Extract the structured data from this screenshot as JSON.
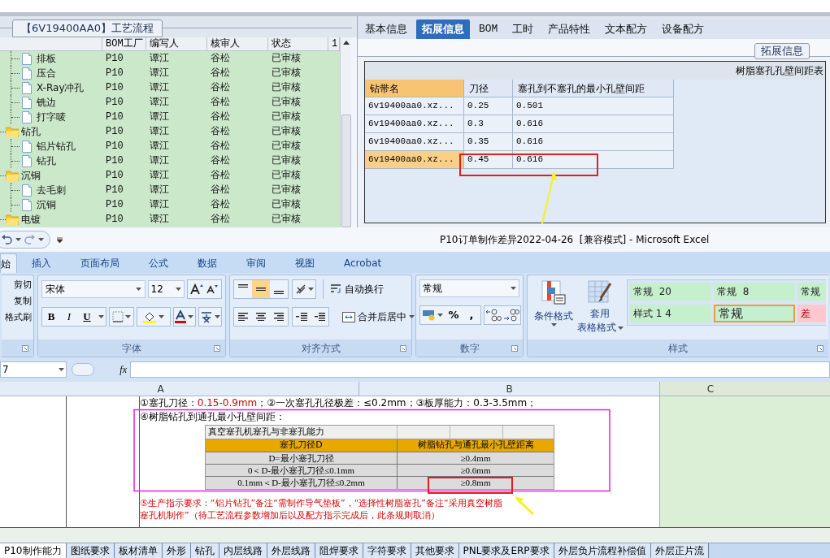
{
  "process_panel": {
    "title": "【6V19400AA0】工艺流程",
    "columns": [
      "BOM工厂",
      "编写人",
      "核审人",
      "状态",
      "1"
    ],
    "tree": [
      {
        "kind": "group",
        "children": [
          {
            "kind": "file",
            "label": "排板",
            "cells": [
              "P10",
              "谭江",
              "谷松",
              "已审核"
            ]
          },
          {
            "kind": "file",
            "label": "压合",
            "cells": [
              "P10",
              "谭江",
              "谷松",
              "已审核"
            ]
          },
          {
            "kind": "file",
            "label": "X-Ray冲孔",
            "cells": [
              "P10",
              "谭江",
              "谷松",
              "已审核"
            ]
          },
          {
            "kind": "file",
            "label": "铣边",
            "cells": [
              "P10",
              "谭江",
              "谷松",
              "已审核"
            ]
          },
          {
            "kind": "file",
            "label": "打字唛",
            "cells": [
              "P10",
              "谭江",
              "谷松",
              "已审核"
            ]
          }
        ]
      },
      {
        "kind": "folder",
        "label": "钻孔",
        "cells": [
          "P10",
          "谭江",
          "谷松",
          "已审核"
        ],
        "children": [
          {
            "kind": "file",
            "label": "铝片钻孔",
            "cells": [
              "P10",
              "谭江",
              "谷松",
              "已审核"
            ]
          },
          {
            "kind": "file",
            "label": "钻孔",
            "cells": [
              "P10",
              "谭江",
              "谷松",
              "已审核"
            ]
          }
        ]
      },
      {
        "kind": "folder",
        "label": "沉铜",
        "cells": [
          "P10",
          "谭江",
          "谷松",
          "已审核"
        ],
        "children": [
          {
            "kind": "file",
            "label": "去毛刺",
            "cells": [
              "P10",
              "谭江",
              "谷松",
              "已审核"
            ]
          },
          {
            "kind": "file",
            "label": "沉铜",
            "cells": [
              "P10",
              "谭江",
              "谷松",
              "已审核"
            ]
          }
        ]
      },
      {
        "kind": "folder",
        "label": "电镀",
        "cells": [
          "P10",
          "谭江",
          "谷松",
          "已审核"
        ]
      }
    ]
  },
  "detail_panel": {
    "tabs": [
      {
        "label": "基本信息",
        "selected": false
      },
      {
        "label": "拓展信息",
        "selected": true
      },
      {
        "label": "BOM",
        "selected": false
      },
      {
        "label": "工时",
        "selected": false
      },
      {
        "label": "产品特性",
        "selected": false
      },
      {
        "label": "文本配方",
        "selected": false
      },
      {
        "label": "设备配方",
        "selected": false
      }
    ],
    "group_title": "拓展信息",
    "table_title": "树脂塞孔孔壁间距表",
    "columns": [
      "钻带名",
      "刀径",
      "塞孔到不塞孔的最小孔壁间距"
    ],
    "rows": [
      {
        "cells": [
          "6v19400aa0.xz...",
          "0.25",
          "0.501"
        ],
        "selected": false
      },
      {
        "cells": [
          "6v19400aa0.xz...",
          "0.3",
          "0.616"
        ],
        "selected": false
      },
      {
        "cells": [
          "6v19400aa0.xz...",
          "0.35",
          "0.616"
        ],
        "selected": false
      },
      {
        "cells": [
          "6v19400aa0.xz...",
          "0.45",
          "0.616"
        ],
        "selected": true
      }
    ]
  },
  "excel": {
    "title": "P10订单制作差异2022-04-26  [兼容模式] - Microsoft Excel",
    "ribbon_tabs": [
      {
        "label": "始",
        "selected": true
      },
      {
        "label": "插入",
        "selected": false
      },
      {
        "label": "页面布局",
        "selected": false
      },
      {
        "label": "公式",
        "selected": false
      },
      {
        "label": "数据",
        "selected": false
      },
      {
        "label": "审阅",
        "selected": false
      },
      {
        "label": "视图",
        "selected": false
      },
      {
        "label": "Acrobat",
        "selected": false
      }
    ],
    "clipboard": {
      "items": [
        "剪切",
        "复制",
        "格式刷"
      ]
    },
    "font": {
      "name": "宋体",
      "size": "12",
      "style_buttons": [
        "B",
        "I",
        "U"
      ],
      "label": "字体"
    },
    "alignment": {
      "vertical": [
        {
          "kind": "top",
          "selected": false
        },
        {
          "kind": "middle",
          "selected": true
        },
        {
          "kind": "bottom",
          "selected": false
        }
      ],
      "wrap": "自动换行",
      "merge": "合并后居中",
      "label": "对齐方式"
    },
    "number": {
      "format": "常规",
      "buttons": [
        "%",
        ","
      ],
      "label": "数字"
    },
    "styles": {
      "conditional": "条件格式",
      "table_format": [
        "套用",
        "表格格式"
      ],
      "cells": [
        {
          "label": "常规  20",
          "kind": "normal",
          "selected": false
        },
        {
          "label": "常规  8",
          "kind": "normal",
          "selected": false
        },
        {
          "label": "常规",
          "kind": "normal",
          "selected": false
        },
        {
          "label": "样式 1 4",
          "kind": "normal",
          "selected": false
        },
        {
          "label": "常规",
          "kind": "normal",
          "selected": true
        },
        {
          "label": "差",
          "kind": "bad",
          "selected": false
        }
      ],
      "label": "样式"
    },
    "name_box": "7",
    "formula_label": "fx",
    "columns": [
      "A",
      "B",
      "C"
    ],
    "lines": [
      [
        {
          "text": "①塞孔刀径：",
          "red": false
        },
        {
          "text": "0.15-0.9mm",
          "red": true
        },
        {
          "text": "；②一次塞孔孔径极差：≤0.2mm；③板厚能力：0.3-3.5mm；",
          "red": false
        }
      ],
      [
        {
          "text": "④树脂钻孔到通孔最小孔壁间距：",
          "red": false
        }
      ]
    ],
    "embedded_table": {
      "title": "真空塞孔机塞孔与非塞孔能力",
      "columns": [
        "塞孔刀径D",
        "树脂钻孔与通孔最小孔壁距离"
      ],
      "rows": [
        [
          "D=最小塞孔刀径",
          "≥0.4mm"
        ],
        [
          "0＜D-最小塞孔刀径≤0.1mm",
          "≥0.6mm"
        ],
        [
          "0.1mm＜D-最小塞孔刀径≤0.2mm",
          "≥0.8mm"
        ]
      ]
    },
    "note": "⑤生产指示要求：“铝片钻孔”备注“需制作导气垫板”，“选择性树脂塞孔”备注“采用真空树脂塞孔机制作”（待工艺流程参数增加后以及配方指示完成后，此条规则取消）",
    "sheet_tabs": [
      {
        "label": "P10制作能力",
        "selected": true
      },
      {
        "label": "图纸要求",
        "selected": false
      },
      {
        "label": "板材清单",
        "selected": false
      },
      {
        "label": "外形",
        "selected": false
      },
      {
        "label": "钻孔",
        "selected": false
      },
      {
        "label": "内层线路",
        "selected": false
      },
      {
        "label": "外层线路",
        "selected": false
      },
      {
        "label": "阻焊要求",
        "selected": false
      },
      {
        "label": "字符要求",
        "selected": false
      },
      {
        "label": "其他要求",
        "selected": false
      },
      {
        "label": "PNL要求及ERP要求",
        "selected": false
      },
      {
        "label": "外层负片流程补偿值",
        "selected": false
      },
      {
        "label": "外层正片流",
        "selected": false
      }
    ]
  }
}
